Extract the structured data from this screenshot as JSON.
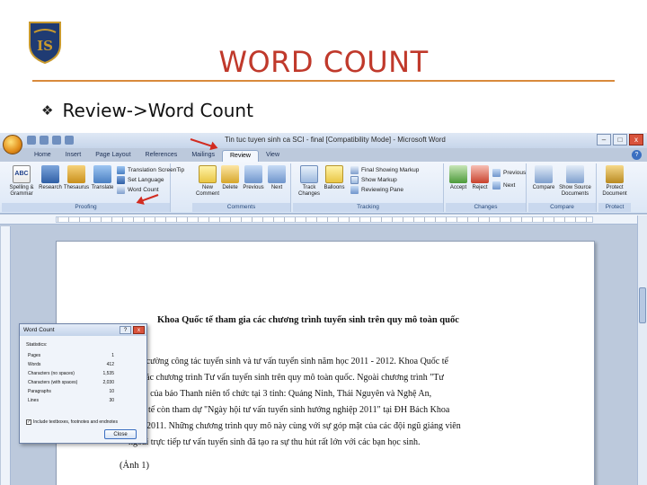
{
  "slide": {
    "title": "WORD COUNT",
    "bullet_text": "Review->Word Count"
  },
  "colors": {
    "title": "#c0392b",
    "rule": "#d98a3c",
    "arrow": "#d22b20",
    "ribbon": "#dce7f6"
  },
  "window": {
    "title": "Tin tuc tuyen sinh ca SCI - final [Compatibility Mode] - Microsoft Word",
    "buttons": [
      "–",
      "□",
      "x"
    ]
  },
  "tabs": [
    "Home",
    "Insert",
    "Page Layout",
    "References",
    "Mailings",
    "Review",
    "View"
  ],
  "active_tab": "Review",
  "ribbon": {
    "proofing": {
      "label": "Proofing",
      "spelling": "Spelling & Grammar",
      "research": "Research",
      "thesaurus": "Thesaurus",
      "translate": "Translate",
      "screentip": "Translation ScreenTip",
      "set_language": "Set Language",
      "word_count": "Word Count"
    },
    "comments": {
      "label": "Comments",
      "new": "New Comment",
      "delete": "Delete",
      "previous": "Previous",
      "next": "Next"
    },
    "tracking": {
      "label": "Tracking",
      "track": "Track Changes",
      "balloons": "Balloons",
      "final": "Final Showing Markup",
      "show_markup": "Show Markup",
      "reviewing_pane": "Reviewing Pane"
    },
    "changes": {
      "label": "Changes",
      "accept": "Accept",
      "reject": "Reject",
      "previous": "Previous",
      "next": "Next"
    },
    "compare": {
      "label": "Compare",
      "compare": "Compare",
      "show_source": "Show Source Documents"
    },
    "protect": {
      "label": "Protect",
      "protect_doc": "Protect Document"
    }
  },
  "document": {
    "heading": "Khoa Quốc tế tham gia các chương trình tuyển sinh trên quy mô toàn quốc",
    "lines": [
      "tăng cường công tác tuyển sinh và tư vấn tuyển sinh năm học 2011 - 2012. Khoa Quốc tế",
      "gia các chương trình Tư vấn tuyển sinh trên quy mô toàn quốc. Ngoài chương trình \"Tư",
      "a thi\" của báo Thanh niên tổ chức tại 3 tỉnh: Quảng Ninh, Thái Nguyên và Nghệ An,",
      "quốc tế còn tham dự \"Ngày hội tư vấn tuyển sinh hướng nghiệp 2011\" tại ĐH Bách Khoa",
      "3.03.2011. Những chương trình quy mô này cùng với sự góp mặt của các đội ngũ giảng viên",
      "ngoài trực tiếp tư vấn tuyển sinh đã tạo ra sự thu hút rất lớn với các bạn học sinh."
    ],
    "caption": "(Ảnh 1)"
  },
  "dialog": {
    "title": "Word Count",
    "statistics_label": "Statistics:",
    "stats": [
      {
        "label": "Pages",
        "value": "1"
      },
      {
        "label": "Words",
        "value": "412"
      },
      {
        "label": "Characters (no spaces)",
        "value": "1,535"
      },
      {
        "label": "Characters (with spaces)",
        "value": "2,030"
      },
      {
        "label": "Paragraphs",
        "value": "10"
      },
      {
        "label": "Lines",
        "value": "30"
      }
    ],
    "checkbox_label": "Include textboxes, footnotes and endnotes",
    "close_label": "Close"
  }
}
